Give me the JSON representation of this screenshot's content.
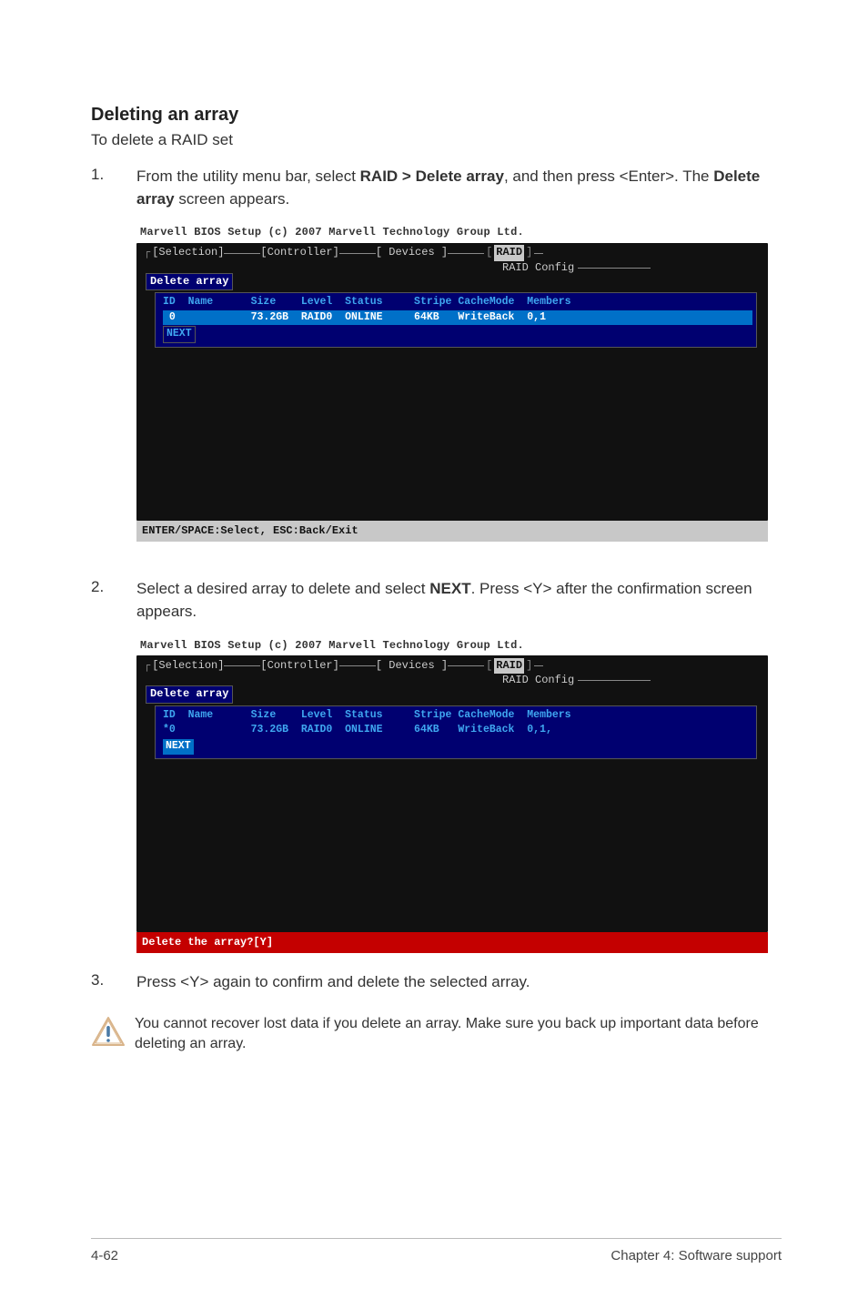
{
  "heading": "Deleting an array",
  "intro": "To delete a RAID set",
  "steps": [
    {
      "num": "1.",
      "text_parts": [
        "From the utility menu bar, select ",
        "RAID > Delete array",
        ", and then press <Enter>. The ",
        "Delete array",
        " screen appears."
      ]
    },
    {
      "num": "2.",
      "text_parts": [
        "Select a desired array to delete and select ",
        "NEXT",
        ". Press <Y> after the confirmation screen appears."
      ]
    },
    {
      "num": "3.",
      "text_parts": [
        "Press <Y> again to confirm and delete the selected array."
      ]
    }
  ],
  "bios": {
    "title": "Marvell BIOS Setup (c) 2007 Marvell Technology Group Ltd.",
    "tabs": {
      "sel": "[Selection]",
      "ctrl": "[Controller]",
      "dev": "[ Devices ]",
      "raid": "RAID"
    },
    "raid_config": "RAID Config",
    "section": "Delete array",
    "header": "ID  Name      Size    Level  Status     Stripe CacheMode  Members",
    "row1": " 0            73.2GB  RAID0  ONLINE     64KB   WriteBack  0,1    ",
    "row2": "*0            73.2GB  RAID0  ONLINE     64KB   WriteBack  0,1,   ",
    "next": "NEXT"
  },
  "statusbar1": "ENTER/SPACE:Select, ESC:Back/Exit",
  "statusbar2": "Delete the array?[Y]",
  "note": "You cannot recover lost data if you delete an array. Make sure you back up important data before deleting an array.",
  "footer_left": "4-62",
  "footer_right": "Chapter 4: Software support"
}
